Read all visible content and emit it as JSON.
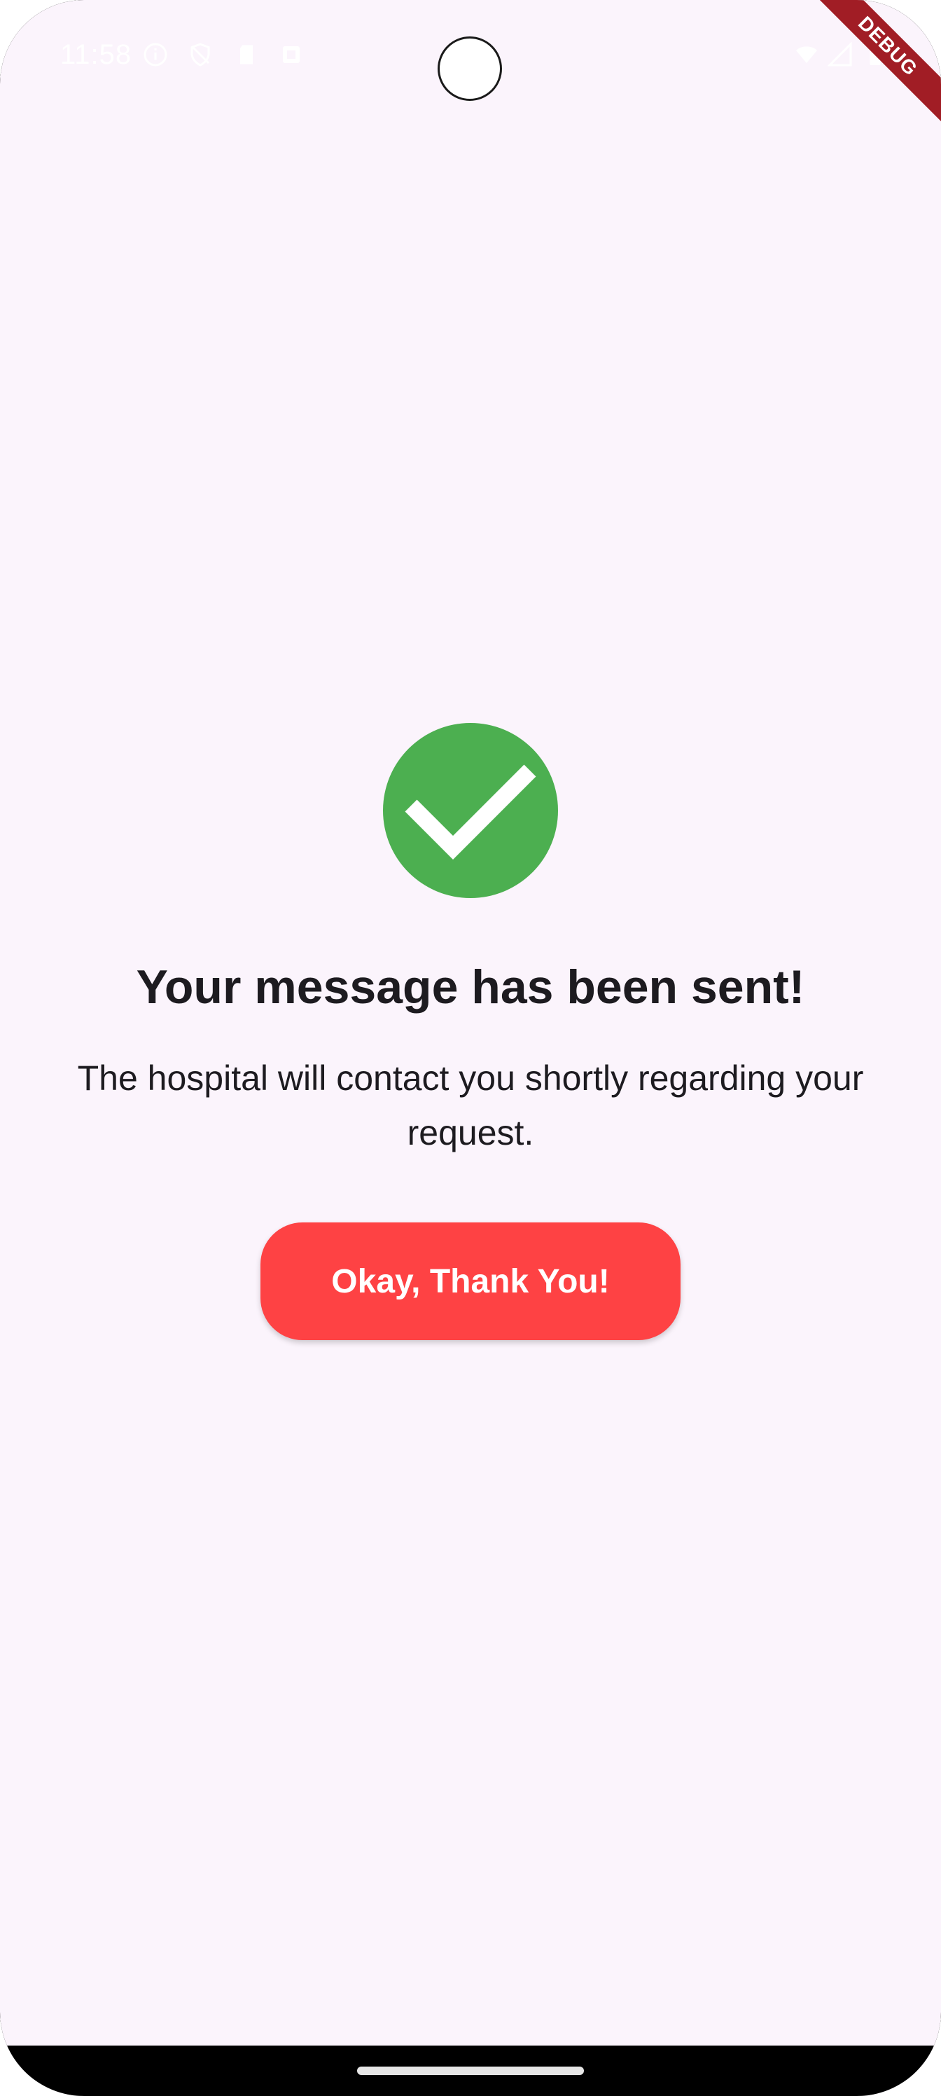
{
  "status_bar": {
    "time": "11:58",
    "icons": [
      "info-icon",
      "vpn-shield-icon",
      "sd-card-icon",
      "notification-icon",
      "wifi-icon",
      "signal-icon",
      "battery-icon"
    ]
  },
  "debug_banner": "DEBUG",
  "confirmation": {
    "icon": "check-circle-icon",
    "icon_color": "#4caf50",
    "title": "Your message has been sent!",
    "message": "The hospital will contact you shortly regarding your request.",
    "button_label": "Okay, Thank You!",
    "button_color": "#fe4244"
  },
  "colors": {
    "background": "#fbf4fc",
    "text": "#1d1b20"
  }
}
